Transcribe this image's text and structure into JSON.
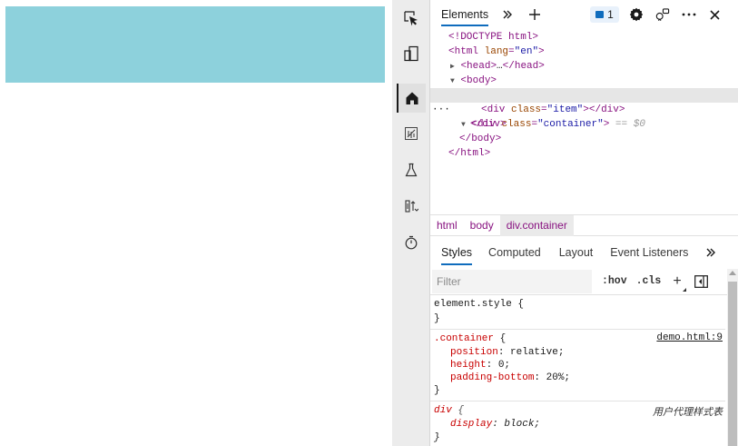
{
  "page": {
    "box_color": "#8dd1dc"
  },
  "activity_bar": {
    "items": [
      {
        "name": "inspect-icon"
      },
      {
        "name": "device-emulation-icon"
      },
      {
        "name": "home-icon"
      },
      {
        "name": "network-icon"
      },
      {
        "name": "experiments-icon"
      },
      {
        "name": "performance-icon"
      },
      {
        "name": "timer-icon"
      }
    ]
  },
  "toolbar": {
    "elements_tab": "Elements",
    "issue_count": "1"
  },
  "dom_tree": {
    "doctype": "<!DOCTYPE html>",
    "html_open_tag": "html",
    "html_attr_name": "lang",
    "html_attr_value": "\"en\"",
    "head_open": "<head>",
    "head_ellipsis": "…",
    "head_close": "</head>",
    "body_open": "<body>",
    "sel_ellipsis": "···",
    "div_tag": "div",
    "div_class_attr": "class",
    "container_value": "\"container\"",
    "sel_suffix": "== $0",
    "item_value": "\"item\"",
    "div_close": "</div>",
    "body_close": "</body>",
    "html_close": "</html>"
  },
  "breadcrumbs": [
    "html",
    "body",
    "div.container"
  ],
  "subtabs": [
    "Styles",
    "Computed",
    "Layout",
    "Event Listeners"
  ],
  "filter": {
    "placeholder": "Filter",
    "hov": ":hov",
    "cls": ".cls",
    "add": "+"
  },
  "styles": {
    "element_style_selector": "element.style {",
    "close_brace": "}",
    "container_selector": ".container",
    "container_source": "demo.html:9",
    "container_props": [
      {
        "name": "position",
        "value": "relative;"
      },
      {
        "name": "height",
        "value": "0;"
      },
      {
        "name": "padding-bottom",
        "value": "20%;"
      }
    ],
    "div_selector": "div",
    "div_source": "用户代理样式表",
    "div_props": [
      {
        "name": "display",
        "value": "block;"
      }
    ]
  }
}
